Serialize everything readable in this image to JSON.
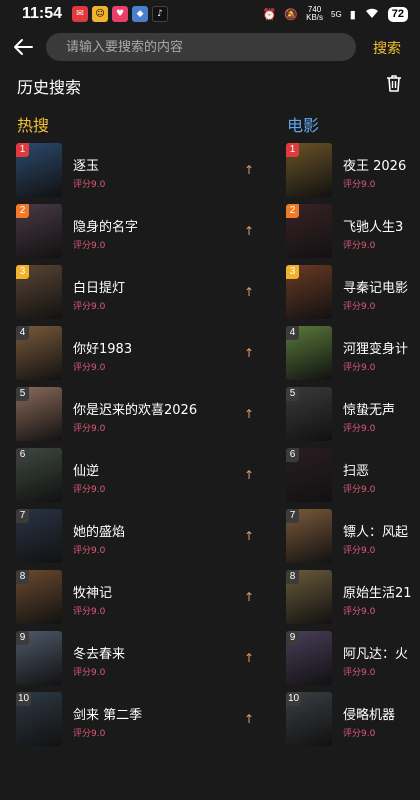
{
  "status": {
    "time": "11:54",
    "net_speed_top": "740",
    "net_speed_bottom": "KB/s",
    "signal": "5G",
    "battery": "72"
  },
  "search": {
    "placeholder": "请输入要搜索的内容",
    "button_label": "搜索"
  },
  "history": {
    "title": "历史搜索"
  },
  "hot": {
    "title": "热搜",
    "trend_icon": "↑",
    "items": [
      {
        "rank": "1",
        "name": "逐玉",
        "rating": "评分9.0"
      },
      {
        "rank": "2",
        "name": "隐身的名字",
        "rating": "评分9.0"
      },
      {
        "rank": "3",
        "name": "白日提灯",
        "rating": "评分9.0"
      },
      {
        "rank": "4",
        "name": "你好1983",
        "rating": "评分9.0"
      },
      {
        "rank": "5",
        "name": "你是迟来的欢喜2026",
        "rating": "评分9.0"
      },
      {
        "rank": "6",
        "name": "仙逆",
        "rating": "评分9.0"
      },
      {
        "rank": "7",
        "name": "她的盛焰",
        "rating": "评分9.0"
      },
      {
        "rank": "8",
        "name": "牧神记",
        "rating": "评分9.0"
      },
      {
        "rank": "9",
        "name": "冬去春来",
        "rating": "评分9.0"
      },
      {
        "rank": "10",
        "name": "剑来 第二季",
        "rating": "评分9.0"
      }
    ]
  },
  "movies": {
    "title": "电影",
    "items": [
      {
        "rank": "1",
        "name": "夜王 2026",
        "rating": "评分9.0"
      },
      {
        "rank": "2",
        "name": "飞驰人生3",
        "rating": "评分9.0"
      },
      {
        "rank": "3",
        "name": "寻秦记电影",
        "rating": "评分9.0"
      },
      {
        "rank": "4",
        "name": "河狸变身计",
        "rating": "评分9.0"
      },
      {
        "rank": "5",
        "name": "惊蛰无声",
        "rating": "评分9.0"
      },
      {
        "rank": "6",
        "name": "扫恶",
        "rating": "评分9.0"
      },
      {
        "rank": "7",
        "name": "镖人：风起",
        "rating": "评分9.0"
      },
      {
        "rank": "8",
        "name": "原始生活21",
        "rating": "评分9.0"
      },
      {
        "rank": "9",
        "name": "阿凡达：火",
        "rating": "评分9.0"
      },
      {
        "rank": "10",
        "name": "侵略机器",
        "rating": "评分9.0"
      }
    ]
  },
  "colors": {
    "rank_1": "#e0393e",
    "rank_2": "#f07a2a",
    "rank_3": "#f1b22c",
    "rank_other": "#3b3b3b",
    "hot_title": "#f1c232",
    "movie_title": "#5fa7e8",
    "rating": "#e05a7a"
  },
  "posters": {
    "hot": [
      "#2c4a6e",
      "#4a3a44",
      "#5a4634",
      "#7a5a3a",
      "#8a6a5a",
      "#3e4a40",
      "#2a3446",
      "#6a4a2e",
      "#4e5a6a",
      "#2e3a44"
    ],
    "movies": [
      "#6a5426",
      "#3a2226",
      "#6a3a24",
      "#5a7a3a",
      "#3a3a3a",
      "#2a1e22",
      "#7a5a3a",
      "#6a5a3a",
      "#4a3e5a",
      "#3a3e44"
    ]
  }
}
